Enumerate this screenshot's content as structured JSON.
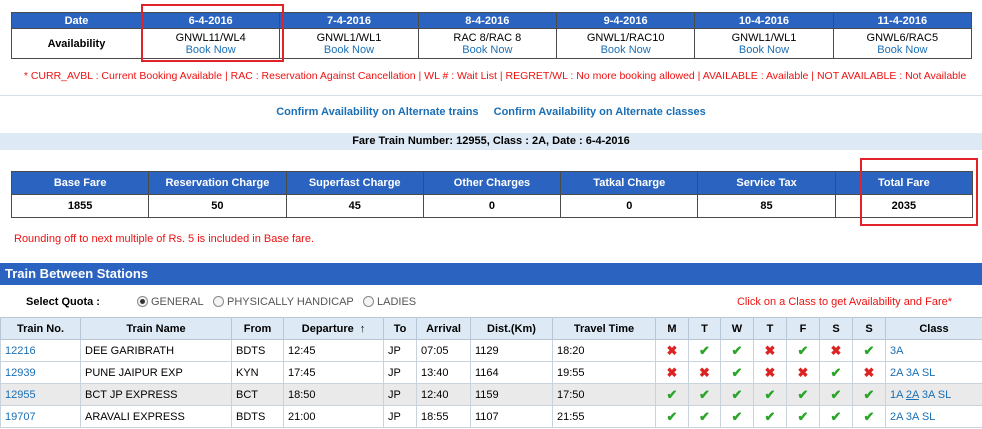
{
  "availability": {
    "date_label": "Date",
    "row_label": "Availability",
    "book_label": "Book Now",
    "columns": [
      {
        "date": "6-4-2016",
        "status": "GNWL11/WL4"
      },
      {
        "date": "7-4-2016",
        "status": "GNWL1/WL1"
      },
      {
        "date": "8-4-2016",
        "status": "RAC 8/RAC 8"
      },
      {
        "date": "9-4-2016",
        "status": "GNWL1/RAC10"
      },
      {
        "date": "10-4-2016",
        "status": "GNWL1/WL1"
      },
      {
        "date": "11-4-2016",
        "status": "GNWL6/RAC5"
      }
    ]
  },
  "legend": "* CURR_AVBL : Current Booking Available | RAC : Reservation Against Cancellation | WL # : Wait List | REGRET/WL : No more booking allowed | AVAILABLE : Available | NOT AVAILABLE : Not Available",
  "alt_links": {
    "trains": "Confirm Availability on Alternate trains",
    "classes": "Confirm Availability on Alternate classes"
  },
  "fare": {
    "title": "Fare Train Number: 12955, Class : 2A, Date : 6-4-2016",
    "headers": [
      "Base Fare",
      "Reservation Charge",
      "Superfast Charge",
      "Other Charges",
      "Tatkal Charge",
      "Service Tax",
      "Total Fare"
    ],
    "values": [
      "1855",
      "50",
      "45",
      "0",
      "0",
      "85",
      "2035"
    ],
    "note": "Rounding off to next multiple of Rs. 5 is included in Base fare."
  },
  "trains_section": {
    "title": "Train Between Stations",
    "quota_label": "Select Quota :",
    "quota_options": [
      "GENERAL",
      "PHYSICALLY HANDICAP",
      "LADIES"
    ],
    "selected_quota": "GENERAL",
    "click_note": "Click on a Class to get Availability and Fare*",
    "headers": [
      "Train No.",
      "Train Name",
      "From",
      "Departure",
      "To",
      "Arrival",
      "Dist.(Km)",
      "Travel Time",
      "M",
      "T",
      "W",
      "T",
      "F",
      "S",
      "S",
      "Class"
    ],
    "sort_icon": "sort-up-arrow-icon",
    "rows": [
      {
        "no": "12216",
        "name": "DEE GARIBRATH",
        "from": "BDTS",
        "dep": "12:45",
        "to": "JP",
        "arr": "07:05",
        "dist": "1129",
        "time": "18:20",
        "days": [
          "N",
          "Y",
          "Y",
          "N",
          "Y",
          "N",
          "Y"
        ],
        "classes": [
          "3A"
        ]
      },
      {
        "no": "12939",
        "name": "PUNE JAIPUR EXP",
        "from": "KYN",
        "dep": "17:45",
        "to": "JP",
        "arr": "13:40",
        "dist": "1164",
        "time": "19:55",
        "days": [
          "N",
          "N",
          "Y",
          "N",
          "N",
          "Y",
          "N"
        ],
        "classes": [
          "2A",
          "3A",
          "SL"
        ]
      },
      {
        "no": "12955",
        "name": "BCT JP EXPRESS",
        "from": "BCT",
        "dep": "18:50",
        "to": "JP",
        "arr": "12:40",
        "dist": "1159",
        "time": "17:50",
        "days": [
          "Y",
          "Y",
          "Y",
          "Y",
          "Y",
          "Y",
          "Y"
        ],
        "classes": [
          "1A",
          "2A",
          "3A",
          "SL"
        ]
      },
      {
        "no": "19707",
        "name": "ARAVALI EXPRESS",
        "from": "BDTS",
        "dep": "21:00",
        "to": "JP",
        "arr": "18:55",
        "dist": "1107",
        "time": "21:55",
        "days": [
          "Y",
          "Y",
          "Y",
          "Y",
          "Y",
          "Y",
          "Y"
        ],
        "classes": [
          "2A",
          "3A",
          "SL"
        ]
      }
    ]
  },
  "colors": {
    "header_blue": "#2a63c0",
    "link_blue": "#1a6fb5",
    "highlight_red": "#e0232b",
    "note_red": "#e11"
  }
}
